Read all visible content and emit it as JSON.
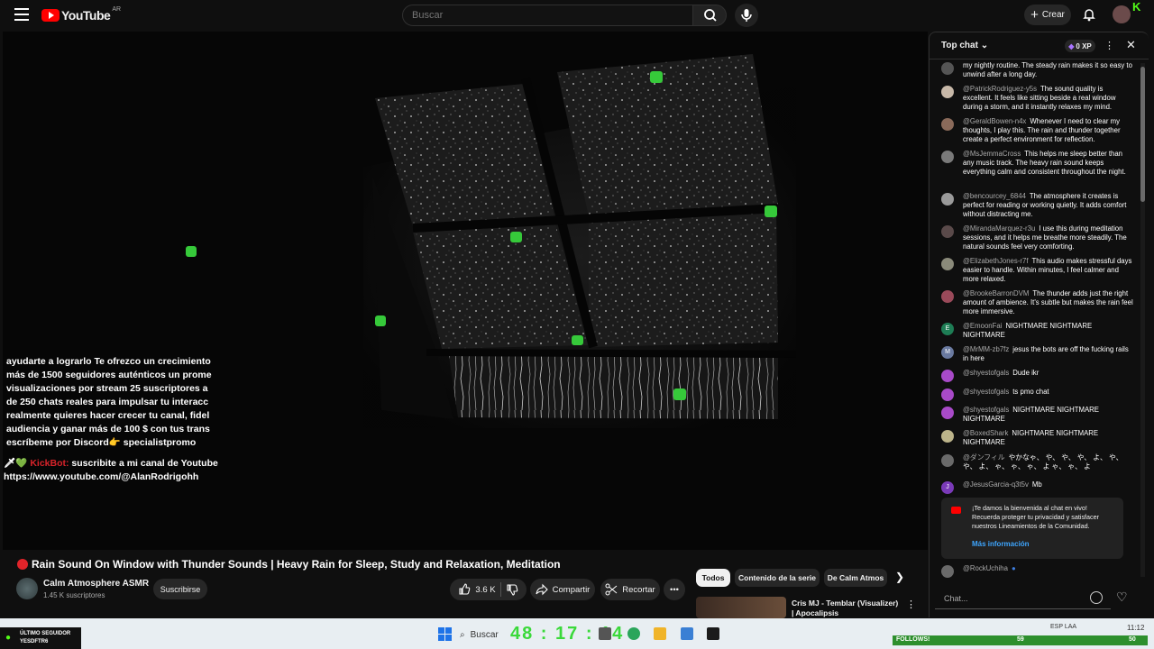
{
  "header": {
    "logo_text": "YouTube",
    "region": "AR",
    "search_placeholder": "Buscar",
    "create_label": "Crear"
  },
  "video": {
    "overlay_lines": [
      "ayudarte a lograrlo Te ofrezco un crecimiento",
      "más de 1500 seguidores auténticos un prome",
      "visualizaciones por stream 25 suscriptores a",
      "de 250 chats reales para impulsar tu interacc",
      "realmente quieres hacer crecer tu canal, fidel",
      "audiencia y ganar más de 100 $ con tus trans",
      "escríbeme por Discord👉 specialistpromo"
    ],
    "kickbot_name": "KickBot:",
    "kickbot_text": "suscribite a mi canal de Youtube",
    "kickbot_url": "https://www.youtube.com/@AlanRodrigohh",
    "title": "Rain Sound On Window with Thunder Sounds | Heavy Rain for Sleep, Study and Relaxation, Meditation",
    "channel_name": "Calm Atmosphere ASMR",
    "subscribers": "1.45 K suscriptores",
    "subscribe_label": "Suscribirse",
    "like_count": "3.6 K",
    "share_label": "Compartir",
    "clip_label": "Recortar"
  },
  "chips": [
    "Todos",
    "Contenido de la serie",
    "De Calm Atmos"
  ],
  "recommendation": {
    "title": "Cris MJ - Temblar (Visualizer) | Apocalipsis"
  },
  "chat": {
    "title": "Top chat",
    "xp": "0 XP",
    "messages": [
      {
        "author": "",
        "text": "my nightly routine. The steady rain makes it so easy to unwind after a long day.",
        "color": "#6d6d6d"
      },
      {
        "author": "@PatrickRodriguez-y5s",
        "text": "The sound quality is excellent. It feels like sitting beside a real window during a storm, and it instantly relaxes my mind.",
        "color": "#c7b8a8"
      },
      {
        "author": "@GeraldBowen-n4x",
        "text": "Whenever I need to clear my thoughts, I play this. The rain and thunder together create a perfect environment for reflection.",
        "color": "#8a6a5a"
      },
      {
        "author": "@MsJemmaCross",
        "text": "This helps me sleep better than any music track. The heavy rain sound keeps everything calm and consistent throughout the night.",
        "color": "#7a7a7a"
      },
      {
        "author": "@bencourcey_6844",
        "text": "The atmosphere it creates is perfect for reading or working quietly. It adds comfort without distracting me.",
        "color": "#9a9a9a"
      },
      {
        "author": "@MirandaMarquez-r3u",
        "text": "I use this during meditation sessions, and it helps me breathe more steadily. The natural sounds feel very comforting.",
        "color": "#5a4a4a"
      },
      {
        "author": "@ElizabethJones-r7f",
        "text": "This audio makes stressful days easier to handle. Within minutes, I feel calmer and more relaxed.",
        "color": "#8a8a7a"
      },
      {
        "author": "@BrookeBarronDVM",
        "text": "The thunder adds just the right amount of ambience. It's subtle but makes the rain feel more immersive.",
        "color": "#9a4a5a"
      },
      {
        "author": "@EmoonFai",
        "text": "NIGHTMARE NIGHTMARE NIGHTMARE",
        "color": "#1e7d55",
        "initial": "E"
      },
      {
        "author": "@MrMM-zb7fz",
        "text": "jesus the bots are off the fucking rails in here",
        "color": "#6a7aa0",
        "initial": "M"
      },
      {
        "author": "@shyestofgals",
        "text": "Dude ikr",
        "color": "#a84ac8"
      },
      {
        "author": "@shyestofgals",
        "text": "ts pmo chat",
        "color": "#a84ac8"
      },
      {
        "author": "@shyestofgals",
        "text": "NIGHTMARE NIGHTMARE NIGHTMARE",
        "color": "#a84ac8"
      },
      {
        "author": "@BoxedShark",
        "text": "NIGHTMARE NIGHTMARE NIGHTMARE",
        "color": "#bcb48a"
      },
      {
        "author": "@ダンフィル",
        "text": "やかなゃ、 や、 や、 や、 よ、 や、 や、 よ、 ゃ、 ゃ、 ゃ、 よ ゃ、 ゃ、 よ",
        "color": "#6a6a6a"
      },
      {
        "author": "@JesusGarcia-q3t5v",
        "text": "Mb",
        "color": "#7a3ab8",
        "initial": "J"
      }
    ],
    "welcome_text": "¡Te damos la bienvenida al chat en vivo! Recuerda proteger tu privacidad y satisfacer nuestros Lineamientos de la Comunidad.",
    "welcome_link": "Más información",
    "last_message_author": "@RockUchiha",
    "input_placeholder": "Chat..."
  },
  "taskbar": {
    "follower_line1": "ÚLTIMO SEGUIDOR",
    "follower_line2": "YESDFTR6",
    "search_label": "Buscar",
    "clock_big": "48 : 17 : 14",
    "follows_label": "FOLLOWS!",
    "follows_count": "59",
    "follows_max": "50",
    "lang": "ESP\nLAA",
    "time": "11:12"
  }
}
